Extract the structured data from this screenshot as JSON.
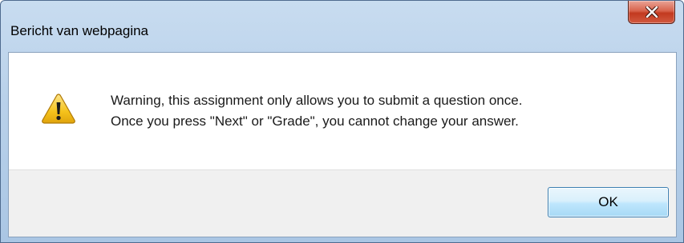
{
  "window": {
    "title": "Bericht van webpagina",
    "close_icon": "close-icon"
  },
  "dialog": {
    "icon": "warning-icon",
    "message_line1": "Warning, this assignment only allows you to submit a question once.",
    "message_line2": "Once you press \"Next\" or \"Grade\", you cannot change your answer.",
    "ok_label": "OK"
  },
  "colors": {
    "close_button": "#c2391f",
    "warning_fill": "#f5c21b",
    "ok_border": "#3c7fb1",
    "title_bar": "#b9d1ea"
  }
}
